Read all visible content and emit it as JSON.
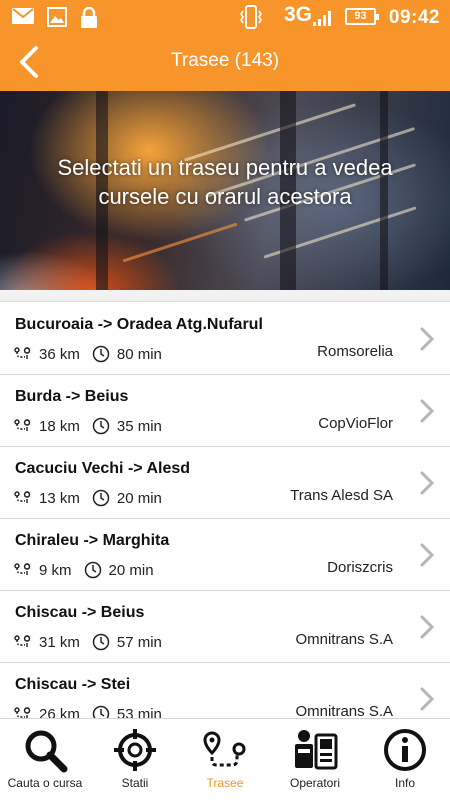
{
  "status_bar": {
    "network": "3G",
    "battery": "93",
    "time": "09:42",
    "icons": [
      "mail-icon",
      "image-icon",
      "lock-icon",
      "vibrate-icon",
      "signal-icon"
    ]
  },
  "header": {
    "title": "Trasee (143)",
    "back_icon": "chevron-left-icon"
  },
  "hero": {
    "text": "Selectati un traseu pentru a vedea cursele cu orarul acestora"
  },
  "routes": [
    {
      "name": "Bucuroaia -> Oradea Atg.Nufarul",
      "distance": "36 km",
      "duration": "80 min",
      "operator": "Romsorelia"
    },
    {
      "name": "Burda -> Beius",
      "distance": "18 km",
      "duration": "35 min",
      "operator": "CopVioFlor"
    },
    {
      "name": "Cacuciu Vechi -> Alesd",
      "distance": "13 km",
      "duration": "20 min",
      "operator": "Trans Alesd SA"
    },
    {
      "name": "Chiraleu -> Marghita",
      "distance": "9 km",
      "duration": "20 min",
      "operator": "Doriszcris"
    },
    {
      "name": "Chiscau -> Beius",
      "distance": "31 km",
      "duration": "57 min",
      "operator": "Omnitrans S.A"
    },
    {
      "name": "Chiscau -> Stei",
      "distance": "26 km",
      "duration": "53 min",
      "operator": "Omnitrans S.A"
    }
  ],
  "bottom_nav": [
    {
      "label": "Cauta o cursa",
      "icon": "search-icon",
      "active": false
    },
    {
      "label": "Statii",
      "icon": "target-icon",
      "active": false
    },
    {
      "label": "Trasee",
      "icon": "route-icon",
      "active": true
    },
    {
      "label": "Operatori",
      "icon": "operator-icon",
      "active": false
    },
    {
      "label": "Info",
      "icon": "info-icon",
      "active": false
    }
  ],
  "colors": {
    "accent": "#f7952a",
    "text": "#111111",
    "divider": "#dcdcdc"
  }
}
